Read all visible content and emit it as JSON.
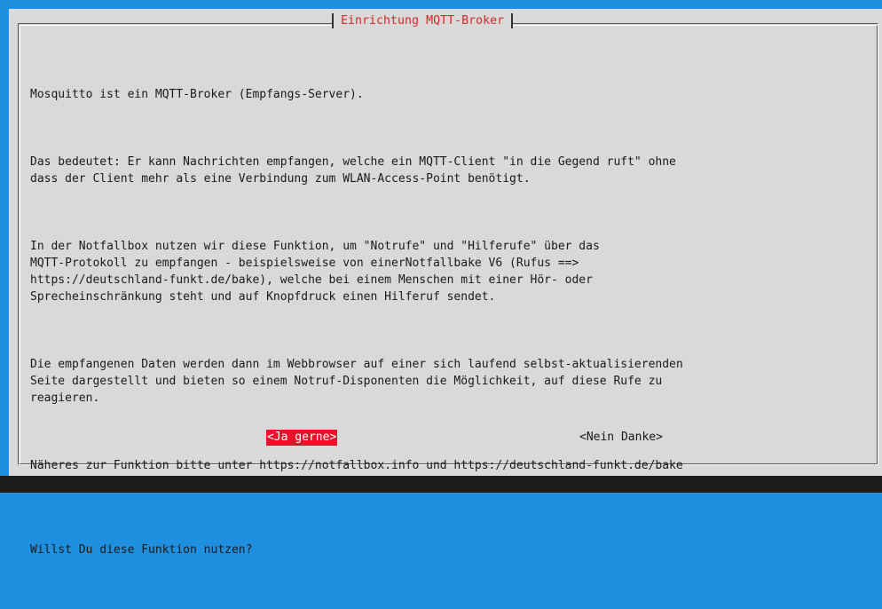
{
  "dialog": {
    "title": "Einrichtung MQTT-Broker",
    "paragraphs": [
      "Mosquitto ist ein MQTT-Broker (Empfangs-Server).",
      "Das bedeutet: Er kann Nachrichten empfangen, welche ein MQTT-Client \"in die Gegend ruft\" ohne\ndass der Client mehr als eine Verbindung zum WLAN-Access-Point benötigt.",
      "In der Notfallbox nutzen wir diese Funktion, um \"Notrufe\" und \"Hilferufe\" über das\nMQTT-Protokoll zu empfangen - beispielsweise von einerNotfallbake V6 (Rufus ==>\nhttps://deutschland-funkt.de/bake), welche bei einem Menschen mit einer Hör- oder\nSprecheinschränkung steht und auf Knopfdruck einen Hilferuf sendet.",
      "Die empfangenen Daten werden dann im Webbrowser auf einer sich laufend selbst-aktualisierenden\nSeite dargestellt und bieten so einem Notruf-Disponenten die Möglichkeit, auf diese Rufe zu\nreagieren.",
      "Näheres zur Funktion bitte unter https://notfallbox.info und https://deutschland-funkt.de/bake\nnachlesen.",
      "Willst Du diese Funktion nutzen?"
    ],
    "buttons": {
      "yes_label": "<Ja gerne>",
      "no_label": "<Nein Danke>"
    }
  },
  "colors": {
    "background": "#1f8fe0",
    "dialog": "#d9d9d9",
    "title_text": "#d62828",
    "selected_button": "#e8122a"
  }
}
